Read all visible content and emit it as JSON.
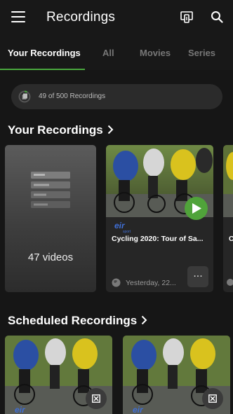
{
  "app_bar": {
    "title": "Recordings",
    "menu_icon": "hamburger-menu-icon",
    "cast_icon": "cast-screen-icon",
    "search_icon": "search-icon"
  },
  "tabs": [
    {
      "label": "Your Recordings",
      "active": true
    },
    {
      "label": "All",
      "active": false
    },
    {
      "label": "Movies",
      "active": false
    },
    {
      "label": "Series",
      "active": false
    }
  ],
  "quota": {
    "text": "49 of 500 Recordings",
    "icon": "storage-ring-icon",
    "used": 49,
    "total": 500
  },
  "your_recordings": {
    "title": "Your Recordings",
    "folder": {
      "count_label": "47 videos",
      "icon": "folder-stack-icon"
    },
    "cards": [
      {
        "title": "Cycling 2020: Tour of Sa...",
        "date": "Yesterday, 22...",
        "brand": "eir sport",
        "play_icon": "play-icon",
        "more_label": "..."
      }
    ]
  },
  "scheduled_recordings": {
    "title": "Scheduled Recordings",
    "delete_icon": "cancel-recording-icon"
  },
  "colors": {
    "accent": "#4aa83e",
    "play": "#50a33a",
    "background": "#161616",
    "card": "#262626"
  }
}
